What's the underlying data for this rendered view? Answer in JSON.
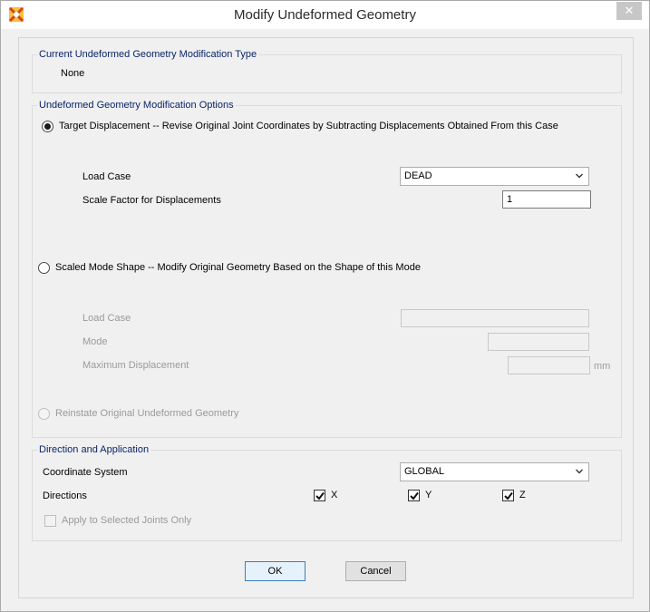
{
  "window": {
    "title": "Modify Undeformed Geometry",
    "close_glyph": "✕"
  },
  "current_type": {
    "group_title": "Current Undeformed Geometry Modification Type",
    "value": "None"
  },
  "options": {
    "group_title": "Undeformed Geometry Modification Options",
    "target_displacement": {
      "label": "Target Displacement -- Revise Original Joint Coordinates by Subtracting Displacements Obtained From this Case",
      "selected": true,
      "load_case_label": "Load Case",
      "load_case_value": "DEAD",
      "scale_factor_label": "Scale Factor for Displacements",
      "scale_factor_value": "1"
    },
    "scaled_mode_shape": {
      "label": "Scaled Mode Shape -- Modify Original Geometry Based on the Shape of this Mode",
      "selected": false,
      "load_case_label": "Load Case",
      "load_case_value": "",
      "mode_label": "Mode",
      "mode_value": "",
      "max_disp_label": "Maximum Displacement",
      "max_disp_value": "",
      "max_disp_unit": "mm"
    },
    "reinstate": {
      "label": "Reinstate Original Undeformed Geometry",
      "selected": false
    }
  },
  "direction": {
    "group_title": "Direction and Application",
    "coord_system_label": "Coordinate System",
    "coord_system_value": "GLOBAL",
    "directions_label": "Directions",
    "x_label": "X",
    "x_checked": true,
    "y_label": "Y",
    "y_checked": true,
    "z_label": "Z",
    "z_checked": true,
    "apply_selected_label": "Apply to Selected Joints Only",
    "apply_selected_checked": false
  },
  "buttons": {
    "ok_label": "OK",
    "cancel_label": "Cancel"
  },
  "icons": {
    "app": "sap-app-icon",
    "close": "close-icon",
    "chevron": "chevron-down-icon",
    "check": "checkmark-icon"
  },
  "colors": {
    "group_title": "#0a246a",
    "disabled_text": "#9a9a9a",
    "ok_border": "#3c7fb1"
  }
}
